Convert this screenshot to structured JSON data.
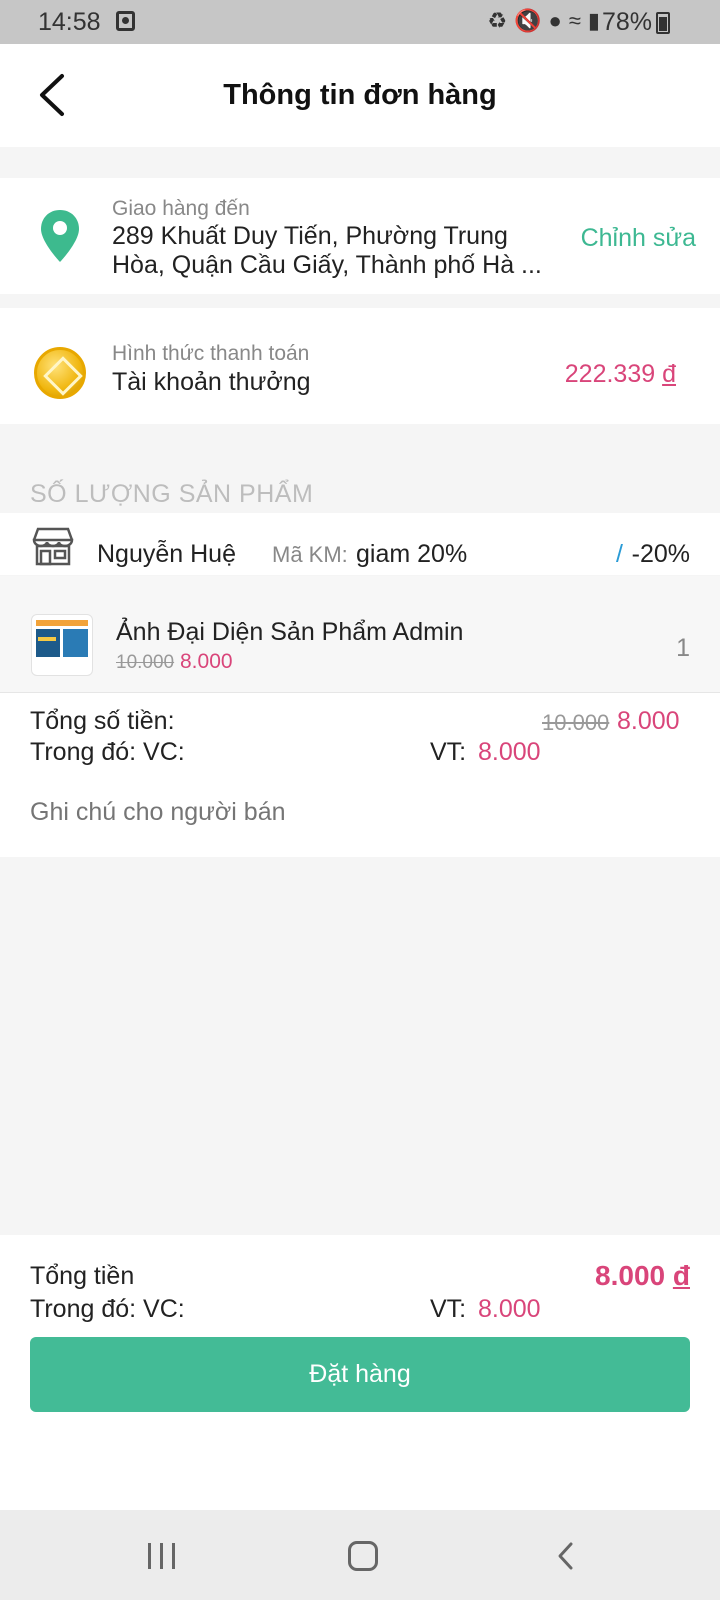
{
  "status_bar": {
    "time": "14:58",
    "battery": "78%"
  },
  "header": {
    "title": "Thông tin đơn hàng"
  },
  "address": {
    "label": "Giao hàng đến",
    "text": "289 Khuất Duy Tiến, Phường Trung Hòa, Quận Cầu Giấy, Thành phố Hà ...",
    "edit_label": "Chỉnh sửa"
  },
  "payment": {
    "label": "Hình thức thanh toán",
    "method": "Tài khoản thưởng",
    "balance": "222.339",
    "currency": "đ"
  },
  "products_section": {
    "title": "SỐ LƯỢNG SẢN PHẨM"
  },
  "shop": {
    "name": "Nguyễn Huệ",
    "promo_label": "Mã KM:",
    "promo_code": "giam 20%",
    "separator": "/",
    "discount": "-20%"
  },
  "product": {
    "name": "Ảnh Đại Diện Sản Phẩm Admin",
    "price_original": "10.000",
    "price_sale": "8.000",
    "quantity": "1"
  },
  "summary": {
    "total_label": "Tổng số tiền:",
    "total_original": "10.000",
    "total_sale": "8.000",
    "shipping_label": "Trong đó: VC:",
    "vt_label": "VT:",
    "vt_value": "8.000",
    "note_placeholder": "Ghi chú cho người bán"
  },
  "footer": {
    "total_label": "Tổng tiền",
    "total_value": "8.000",
    "currency": "đ",
    "shipping_label": "Trong đó: VC:",
    "vt_label": "VT:",
    "vt_value": "8.000",
    "order_button": "Đặt hàng"
  },
  "colors": {
    "accent_green": "#43bb96",
    "price_pink": "#d9457a",
    "link_green": "#3db892"
  }
}
